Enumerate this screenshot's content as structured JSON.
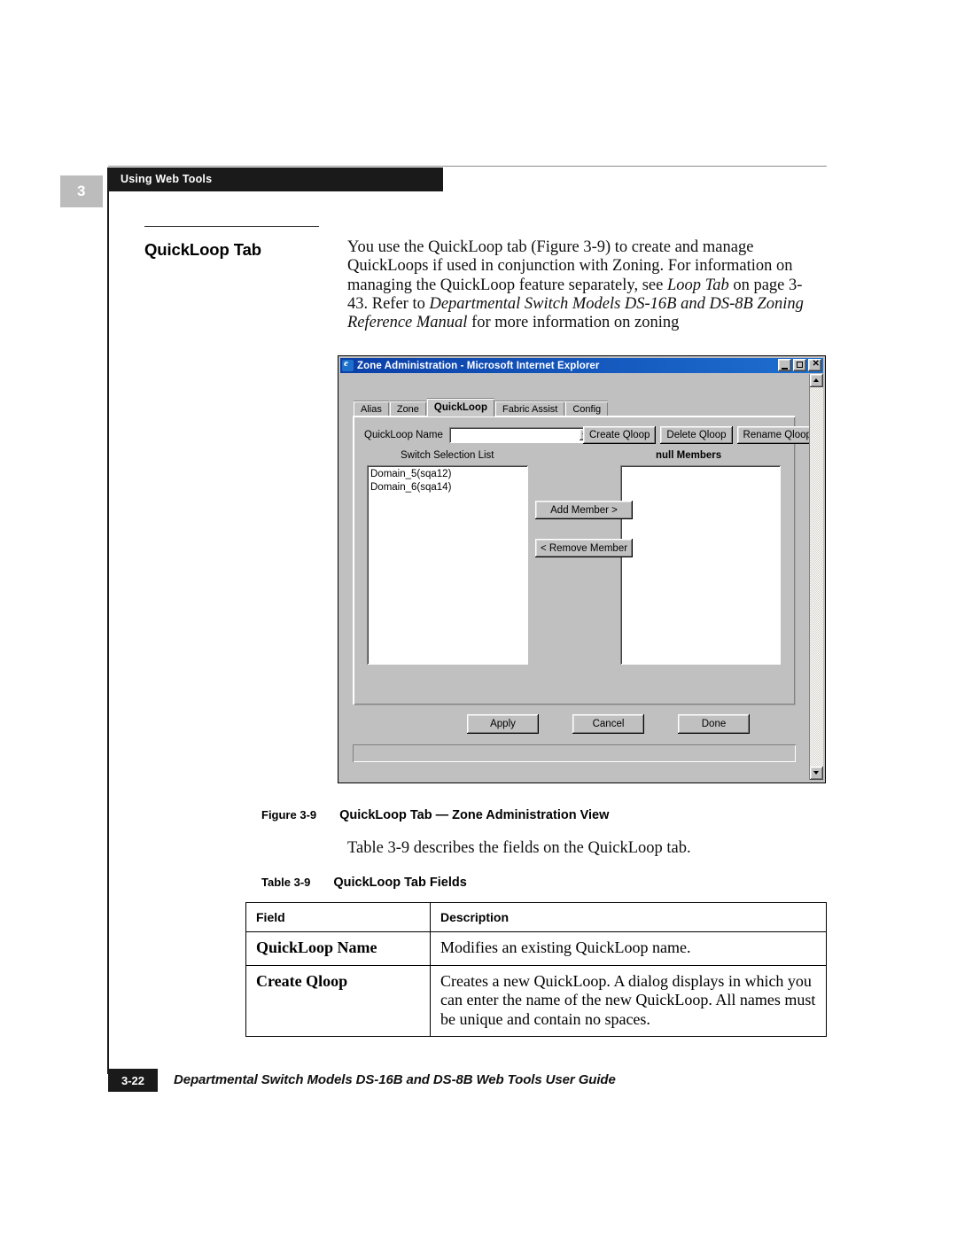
{
  "page": {
    "chapter_number": "3",
    "running_head": "Using Web Tools",
    "footer_page_number": "3-22",
    "footer_title": "Departmental Switch Models DS-16B and DS-8B Web Tools User Guide"
  },
  "section": {
    "heading": "QuickLoop Tab",
    "body_html": "You use the QuickLoop tab (Figure 3-9) to create and manage QuickLoops if used in conjunction with Zoning. For information on managing the QuickLoop feature separately, see <i>Loop Tab</i> on page 3-43. Refer to <i>Departmental Switch Models DS-16B and DS-8B Zoning Reference Manual</i> for more information on zoning"
  },
  "screenshot": {
    "window": {
      "title": "Zone Administration - Microsoft Internet Explorer",
      "icon": "ie-icon",
      "buttons": {
        "minimize": "minimize-icon",
        "maximize": "maximize-icon",
        "close": "close-icon"
      }
    },
    "tabs": [
      {
        "label": "Alias",
        "active": false
      },
      {
        "label": "Zone",
        "active": false
      },
      {
        "label": "QuickLoop",
        "active": true
      },
      {
        "label": "Fabric Assist",
        "active": false
      },
      {
        "label": "Config",
        "active": false
      }
    ],
    "name_field": {
      "label": "QuickLoop Name",
      "value": "",
      "placeholder": ""
    },
    "top_buttons": [
      "Create Qloop",
      "Delete Qloop",
      "Rename Qloop"
    ],
    "left_list": {
      "header": "Switch Selection List",
      "items": [
        "Domain_5(sqa12)",
        "Domain_6(sqa14)"
      ]
    },
    "right_list": {
      "header": "null Members",
      "items": []
    },
    "transfer_buttons": [
      "Add Member >",
      "< Remove Member"
    ],
    "dialog_buttons": [
      "Apply",
      "Cancel",
      "Done"
    ],
    "status_text": ""
  },
  "figure_caption": {
    "number": "Figure 3-9",
    "text": "QuickLoop Tab — Zone Administration View"
  },
  "table_intro": "Table 3-9 describes the fields on the QuickLoop tab.",
  "table_caption": {
    "number": "Table 3-9",
    "text": "QuickLoop Tab Fields"
  },
  "fields_table": {
    "headers": [
      "Field",
      "Description"
    ],
    "rows": [
      {
        "field": "QuickLoop Name",
        "description": "Modifies an existing QuickLoop name."
      },
      {
        "field": "Create Qloop",
        "description": "Creates a new QuickLoop. A dialog displays in which you can enter the name of the new QuickLoop. All names must be unique and contain no spaces."
      }
    ]
  },
  "colors": {
    "header_bar": "#1a1a1a",
    "chapter_badge": "#bcbcbc",
    "titlebar": "#0b3fa8",
    "dialog_face": "#c0c0c0"
  }
}
